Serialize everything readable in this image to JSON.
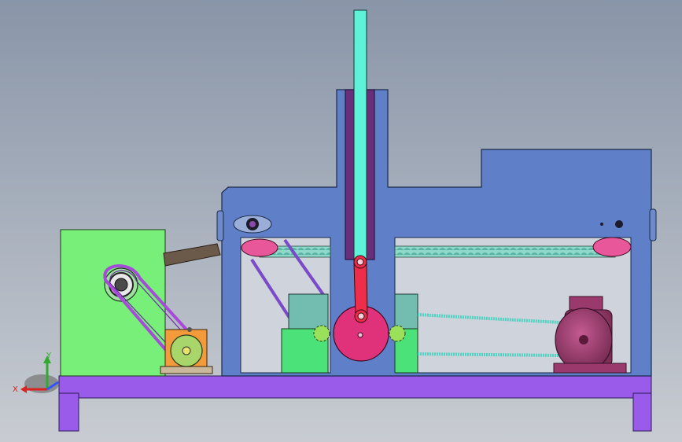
{
  "viewport": {
    "title": ""
  },
  "triad": {
    "x_label": "X",
    "y_label": "Y"
  },
  "colors": {
    "bg_top": "#8995a8",
    "bg_bottom": "#c8ccd2",
    "base": "#9b5bea",
    "frame": "#5f80c8",
    "slider": "#5ef2d9",
    "green_box": "#78ef78",
    "green_part": "#4be27a",
    "crank_disc": "#e0327a",
    "crank_arm": "#ee2d4a",
    "motor": "#aa3f78",
    "teal_gear": "#73bdb0",
    "orange_mount": "#f39a3a",
    "purple_belt": "#a64bd8",
    "cyan_belt": "#52d2c2",
    "pink_pulley": "#e8579a"
  }
}
